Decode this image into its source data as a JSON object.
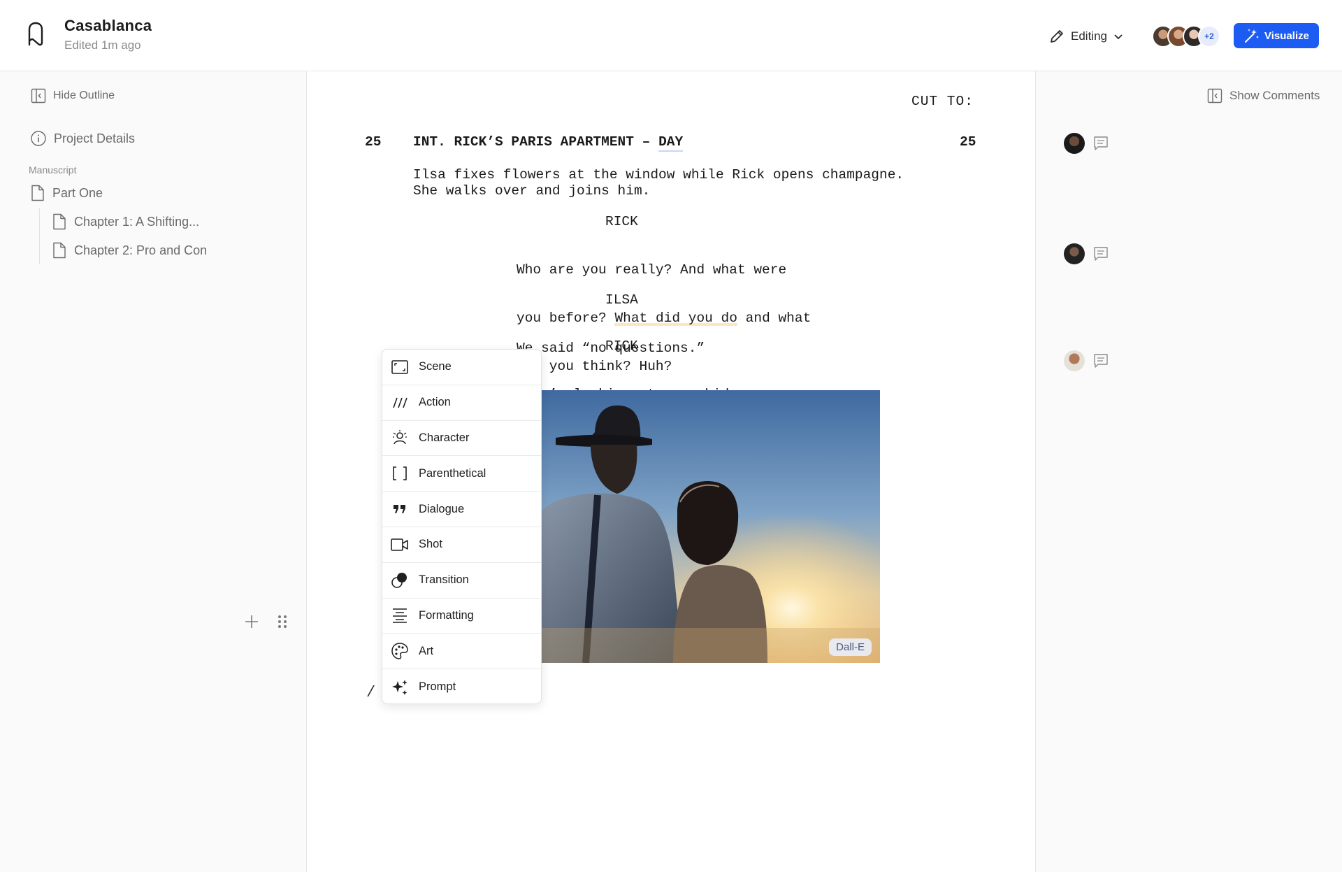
{
  "header": {
    "title": "Casablanca",
    "subtitle": "Edited  1m ago",
    "mode_label": "Editing",
    "collaborators_more": "+2",
    "visualize_label": "Visualize"
  },
  "sidebar": {
    "hide_outline": "Hide Outline",
    "project_details": "Project Details",
    "section_label": "Manuscript",
    "items": [
      {
        "label": "Part One"
      },
      {
        "label": "Chapter 1: A Shifting..."
      },
      {
        "label": "Chapter 2: Pro and Con"
      }
    ]
  },
  "script": {
    "transition": "CUT TO:",
    "scene_number": "25",
    "slug_main": "INT. RICK’S PARIS APARTMENT – ",
    "slug_time": "DAY",
    "action_line1": "Ilsa fixes flowers at the window while Rick opens champagne.",
    "action_line2": "She walks over and joins him.",
    "block1": {
      "character": "RICK",
      "line1": "Who are you really? And what were",
      "line2_a": "you before? ",
      "line2_hl": "What did you do",
      "line2_b": " and what",
      "line3": "did you think? Huh?"
    },
    "block2": {
      "character": "ILSA",
      "line1": "We said “no questions.”"
    },
    "block3": {
      "character": "RICK",
      "line1": "e’s looking at you, kid."
    },
    "slash": "/",
    "image_badge": "Dall-E"
  },
  "slash_menu": {
    "items": [
      {
        "label": "Scene",
        "icon": "scene-icon"
      },
      {
        "label": "Action",
        "icon": "action-icon"
      },
      {
        "label": "Character",
        "icon": "character-icon"
      },
      {
        "label": "Parenthetical",
        "icon": "parenthetical-icon"
      },
      {
        "label": "Dialogue",
        "icon": "dialogue-icon"
      },
      {
        "label": "Shot",
        "icon": "shot-icon"
      },
      {
        "label": "Transition",
        "icon": "transition-icon"
      },
      {
        "label": "Formatting",
        "icon": "formatting-icon"
      },
      {
        "label": "Art",
        "icon": "art-icon"
      },
      {
        "label": "Prompt",
        "icon": "prompt-icon"
      }
    ]
  },
  "comments": {
    "show_comments": "Show Comments"
  },
  "colors": {
    "accent": "#1d5cf2",
    "highlight_yellow": "#fde7bf",
    "highlight_green": "#cfeed8",
    "highlight_blue": "#c9d6f7"
  }
}
